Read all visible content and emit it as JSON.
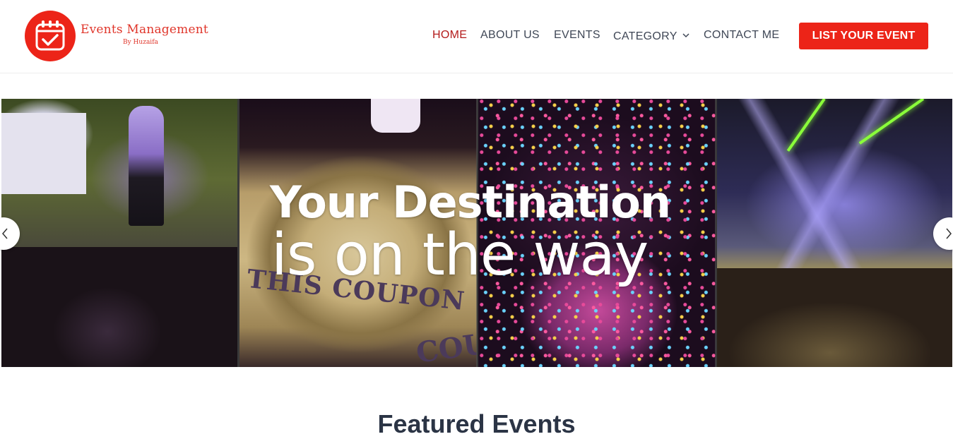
{
  "brand": {
    "name": "Events Management",
    "byline": "By Huzaifa",
    "logo_icon": "calendar-check-icon",
    "accent": "#ec2418"
  },
  "nav": {
    "items": [
      {
        "label": "HOME",
        "active": true
      },
      {
        "label": "ABOUT US",
        "active": false
      },
      {
        "label": "EVENTS",
        "active": false
      },
      {
        "label": "CATEGORY",
        "active": false,
        "has_dropdown": true
      },
      {
        "label": "CONTACT ME",
        "active": false
      }
    ],
    "active_color": "#b31b1b",
    "text_color": "#3f4756"
  },
  "cta": {
    "label": "LIST YOUR EVENT"
  },
  "hero": {
    "title": "Your Destination",
    "subtitle": "is on the way",
    "ticket_text_1": "THIS COUPON",
    "ticket_text_2": "COU",
    "prev_icon": "chevron-left-icon",
    "next_icon": "chevron-right-icon"
  },
  "featured": {
    "heading": "Featured Events"
  }
}
